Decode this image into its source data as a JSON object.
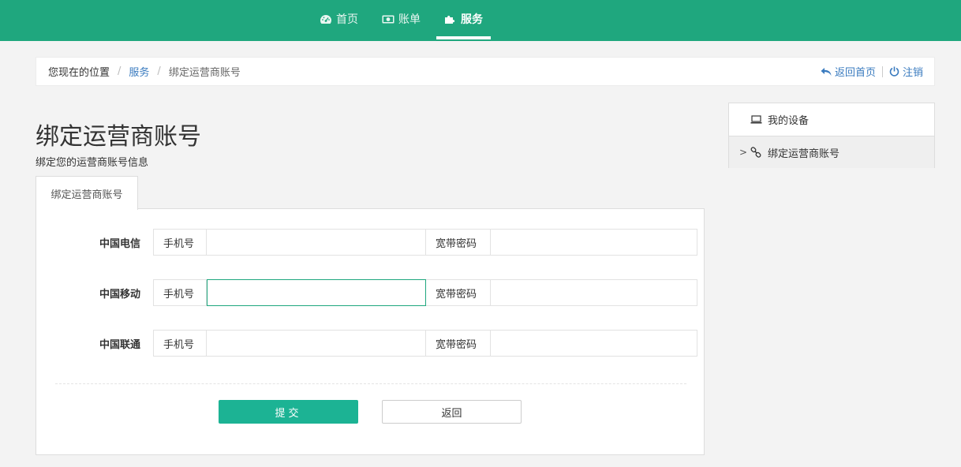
{
  "nav": {
    "items": [
      {
        "label": "首页",
        "icon": "dashboard-icon"
      },
      {
        "label": "账单",
        "icon": "money-icon"
      },
      {
        "label": "服务",
        "icon": "puzzle-icon",
        "active": true
      }
    ]
  },
  "breadcrumb": {
    "here": "您现在的位置",
    "separator": "/",
    "link": "服务",
    "current": "绑定运营商账号",
    "home_link": "返回首页",
    "logout_link": "注销"
  },
  "page": {
    "title": "绑定运营商账号",
    "subtitle": "绑定您的运营商账号信息",
    "tab": "绑定运营商账号"
  },
  "form": {
    "rows": [
      {
        "carrier": "中国电信",
        "phone_label": "手机号",
        "phone_value": "",
        "pwd_label": "宽带密码",
        "pwd_value": ""
      },
      {
        "carrier": "中国移动",
        "phone_label": "手机号",
        "phone_value": "",
        "pwd_label": "宽带密码",
        "pwd_value": ""
      },
      {
        "carrier": "中国联通",
        "phone_label": "手机号",
        "phone_value": "",
        "pwd_label": "宽带密码",
        "pwd_value": ""
      }
    ],
    "submit": "提交",
    "back": "返回"
  },
  "sidebar": {
    "items": [
      {
        "label": "我的设备",
        "icon": "laptop-icon"
      },
      {
        "label": "绑定运营商账号",
        "icon": "link-icon",
        "caret": ">"
      }
    ]
  },
  "colors": {
    "brand": "#1fa77e",
    "button": "#1cb394",
    "link": "#3a7bbf"
  }
}
